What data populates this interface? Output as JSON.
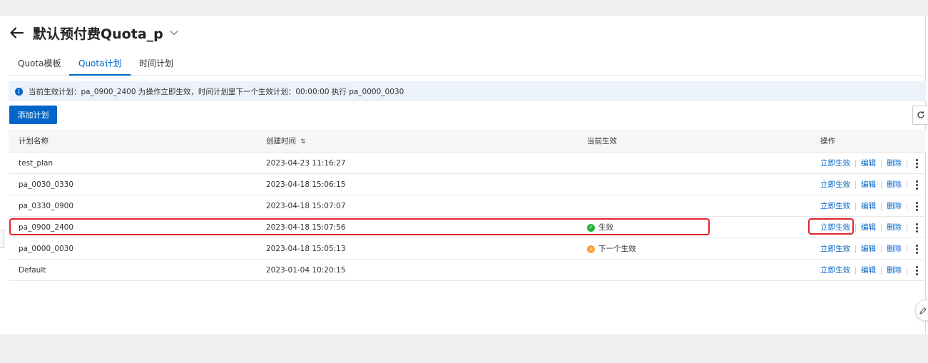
{
  "header": {
    "title": "默认预付费Quota_p"
  },
  "tabs": [
    {
      "label": "Quota模板",
      "active": false
    },
    {
      "label": "Quota计划",
      "active": true
    },
    {
      "label": "时间计划",
      "active": false
    }
  ],
  "notice": {
    "text": "当前生效计划：pa_0900_2400 为操作立即生效，时间计划里下一个生效计划：00:00:00 执行 pa_0000_0030"
  },
  "toolbar": {
    "add_label": "添加计划"
  },
  "table": {
    "columns": {
      "name": "计划名称",
      "time": "创建时间",
      "status": "当前生效",
      "ops": "操作"
    },
    "op_labels": {
      "activate": "立即生效",
      "edit": "编辑",
      "delete": "删除"
    },
    "rows": [
      {
        "name": "test_plan",
        "time": "2023-04-23 11:16:27",
        "status": ""
      },
      {
        "name": "pa_0030_0330",
        "time": "2023-04-18 15:06:15",
        "status": ""
      },
      {
        "name": "pa_0330_0900",
        "time": "2023-04-18 15:07:07",
        "status": ""
      },
      {
        "name": "pa_0900_2400",
        "time": "2023-04-18 15:07:56",
        "status": "生效"
      },
      {
        "name": "pa_0000_0030",
        "time": "2023-04-18 15:05:13",
        "status": "下一个生效"
      },
      {
        "name": "Default",
        "time": "2023-01-04 10:20:15",
        "status": ""
      }
    ]
  },
  "colors": {
    "primary": "#0064c8",
    "active_status": "#1fb53e",
    "next_status": "#f6a33a",
    "highlight": "#e3222e"
  },
  "icons": {
    "back": "arrow-left-icon",
    "title_dropdown": "chevron-down-icon",
    "info": "info-icon",
    "sort": "sort-icon",
    "refresh": "refresh-icon",
    "more": "more-vertical-icon"
  }
}
